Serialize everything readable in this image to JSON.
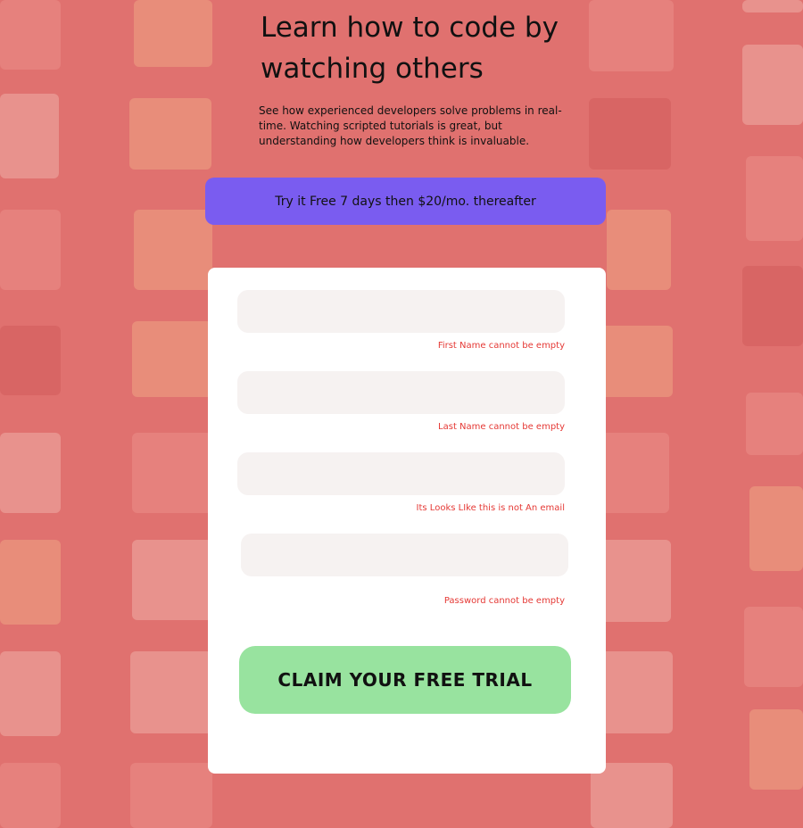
{
  "hero": {
    "headline": "Learn how to code by watching others",
    "description": "See how experienced developers solve problems in real-time. Watching scripted tutorials is great, but understanding how developers think is invaluable."
  },
  "offer": {
    "banner_text": "Try it Free 7 days then $20/mo. thereafter"
  },
  "form": {
    "first_name": {
      "value": "",
      "error": "First Name cannot be empty"
    },
    "last_name": {
      "value": "",
      "error": "Last Name cannot be empty"
    },
    "email": {
      "value": "",
      "error": "Its Looks LIke this is not An email"
    },
    "password": {
      "value": "",
      "error": "Password cannot be empty"
    },
    "submit_label": "CLAIM YOUR FREE TRIAL"
  },
  "colors": {
    "background": "#e0716f",
    "banner": "#7a5cf0",
    "cta": "#98e39f",
    "error": "#e53935",
    "input_bg": "#f6f2f1"
  }
}
